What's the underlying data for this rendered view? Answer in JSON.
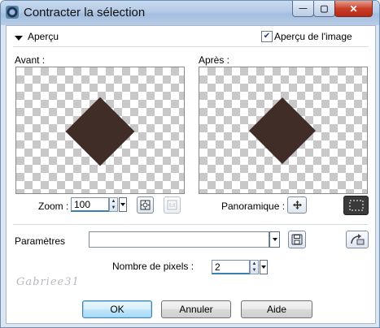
{
  "window": {
    "title": "Contracter la sélection",
    "min_glyph": "—",
    "max_glyph": "▢",
    "close_glyph": "✕"
  },
  "preview": {
    "section_label": "Aperçu",
    "image_preview_label": "Aperçu de l'image",
    "image_preview_checked": true,
    "before_label": "Avant :",
    "after_label": "Après :"
  },
  "zoom": {
    "label": "Zoom :",
    "value": "100"
  },
  "pan": {
    "label": "Panoramique :"
  },
  "settings": {
    "label": "Paramètres",
    "preset_value": ""
  },
  "pixels": {
    "label": "Nombre de pixels :",
    "value": "2"
  },
  "buttons": {
    "ok": "OK",
    "cancel": "Annuler",
    "help": "Aide"
  },
  "watermark": "Gabriee31",
  "colors": {
    "shape": "#402d27",
    "accent": "#3c7fb1"
  }
}
